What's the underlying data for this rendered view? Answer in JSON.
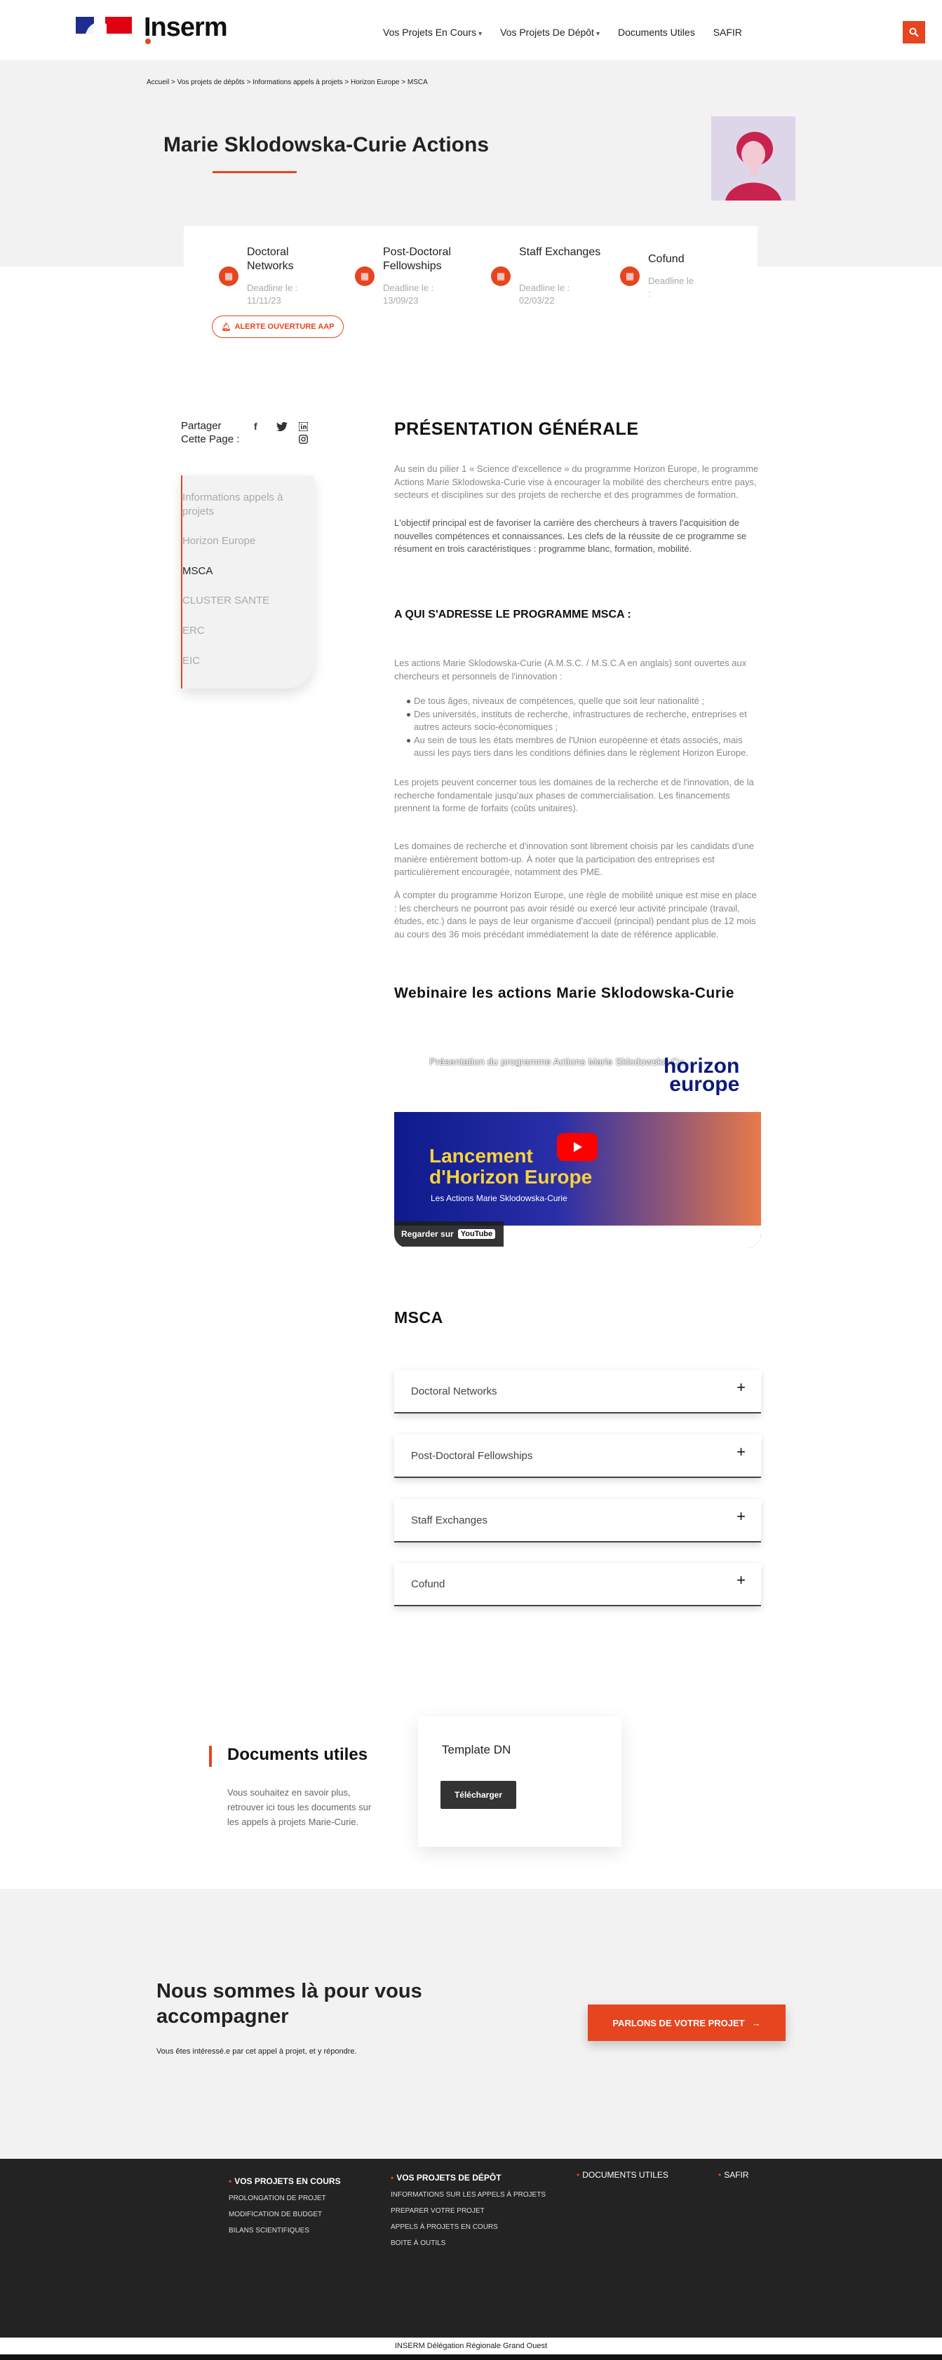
{
  "header": {
    "logo_text": "Inserm",
    "nav": [
      {
        "label": "Vos Projets En Cours",
        "has_caret": true
      },
      {
        "label": "Vos Projets De Dépôt",
        "has_caret": true
      },
      {
        "label": "Documents Utiles",
        "has_caret": false
      },
      {
        "label": "SAFIR",
        "has_caret": false
      }
    ],
    "search_icon": "search-icon"
  },
  "breadcrumb": "Accueil > Vos projets de dépôts > Informations appels à projets > Horizon Europe > MSCA",
  "page_title": "Marie Sklodowska-Curie Actions",
  "deadlines": [
    {
      "name": "Doctoral Networks",
      "deadline_label": "Deadline le :",
      "date": "11/11/23"
    },
    {
      "name": "Post-Doctoral Fellowships",
      "deadline_label": "Deadline le :",
      "date": "13/09/23"
    },
    {
      "name": "Staff Exchanges",
      "deadline_label": "Deadline le :",
      "date": "02/03/22"
    },
    {
      "name": "Cofund",
      "deadline_label": "Deadline le",
      "date": ":"
    }
  ],
  "alert_button": "ALERTE OUVERTURE AAP",
  "share": {
    "label_line1": "Partager",
    "label_line2": "Cette Page :"
  },
  "sidebar": {
    "items": [
      {
        "label": "Informations appels à projets",
        "active": false
      },
      {
        "label": "Horizon Europe",
        "active": false
      },
      {
        "label": "MSCA",
        "active": true
      },
      {
        "label": "CLUSTER SANTE",
        "active": false
      },
      {
        "label": "ERC",
        "active": false
      },
      {
        "label": "EIC",
        "active": false
      }
    ]
  },
  "content": {
    "section_title": "PRÉSENTATION GÉNÉRALE",
    "intro_p1": "Au sein du pilier 1 « Science d'excellence » du programme Horizon Europe, le programme Actions Marie Sklodowska-Curie vise à encourager la mobilité des chercheurs entre pays, secteurs et disciplines sur des projets de recherche et des programmes de formation.",
    "intro_p2": "L'objectif principal est de favoriser la carrière des chercheurs à travers l'acquisition de nouvelles compétences et connaissances. Les clefs de la réussite de ce programme se résument en trois caractéristiques : programme blanc, formation, mobilité.",
    "audience_title": "A QUI S'ADRESSE LE PROGRAMME MSCA :",
    "audience_intro": "Les actions Marie Sklodowska-Curie (A.M.S.C. / M.S.C.A en anglais) sont ouvertes aux chercheurs et personnels de l'innovation :",
    "audience_bullets": [
      "De tous âges, niveaux de compétences, quelle que soit leur nationalité ;",
      "Des universités, instituts de recherche, infrastructures de recherche, entreprises et autres acteurs socio-économiques ;",
      "Au sein de tous les états membres de l'Union européenne et états associés, mais aussi les pays tiers dans les conditions définies dans le règlement Horizon Europe."
    ],
    "audience_p2": "Les projets peuvent concerner tous les domaines de la recherche et de l'innovation, de la recherche fondamentale jusqu'aux phases de commercialisation. Les financements prennent la forme de forfaits (coûts unitaires).",
    "audience_p3": "Les domaines de recherche et d'innovation sont librement choisis par les candidats d'une manière entièrement bottom-up. À noter que la participation des entreprises est particulièrement encouragée, notamment des PME.",
    "audience_p4": "À compter du programme Horizon Europe, une règle de mobilité unique est mise en place : les chercheurs ne pourront pas avoir résidé ou exercé leur activité principale (travail, études, etc.) dans le pays de leur organisme d'accueil (principal) pendant plus de 12 mois au cours des 36 mois précédant immédiatement la date de référence applicable.",
    "webinar_title": "Webinaire les actions Marie Sklodowska-Curie",
    "video": {
      "title": "Présentation du programme Actions Marie Sklodowska-Cu...",
      "launch_line1": "Lancement",
      "launch_line2": "d'Horizon Europe",
      "subtitle": "Les Actions Marie Sklodowska-Curie",
      "watch_on": "Regarder sur",
      "youtube": "YouTube",
      "brand_line1": "horizon",
      "brand_line2": "europe"
    },
    "msca_title": "MSCA",
    "accordion": [
      "Doctoral Networks",
      "Post-Doctoral Fellowships",
      "Staff Exchanges",
      "Cofund"
    ]
  },
  "documents": {
    "title": "Documents utiles",
    "description": "Vous souhaitez en savoir plus, retrouver ici tous les documents sur les appels à projets Marie-Curie.",
    "card_title": "Template DN",
    "download_label": "Télécharger"
  },
  "contact": {
    "title": "Nous sommes là pour vous accompagner",
    "subtitle": "Vous êtes intéressé.e par cet appel à projet, et y répondre.",
    "button": "PARLONS DE VOTRE PROJET"
  },
  "footer": {
    "columns": [
      {
        "heading": "VOS PROJETS EN COURS",
        "links": [
          "PROLONGATION DE PROJET",
          "MODIFICATION DE BUDGET",
          "BILANS SCIENTIFIQUES"
        ]
      },
      {
        "heading": "VOS PROJETS DE DÉPÔT",
        "links": [
          "INFORMATIONS SUR LES APPELS À PROJETS",
          "PREPARER VOTRE PROJET",
          "APPELS À PROJETS EN COURS",
          "BOITE À OUTILS"
        ]
      },
      {
        "heading": "DOCUMENTS UTILES",
        "links": []
      },
      {
        "heading": "SAFIR",
        "links": []
      }
    ],
    "bottom_text": "INSERM Délégation Régionale Grand Ouest"
  },
  "colors": {
    "accent": "#e6451f",
    "footer_bg": "#232323",
    "hero_bg": "#f2f2f2"
  }
}
